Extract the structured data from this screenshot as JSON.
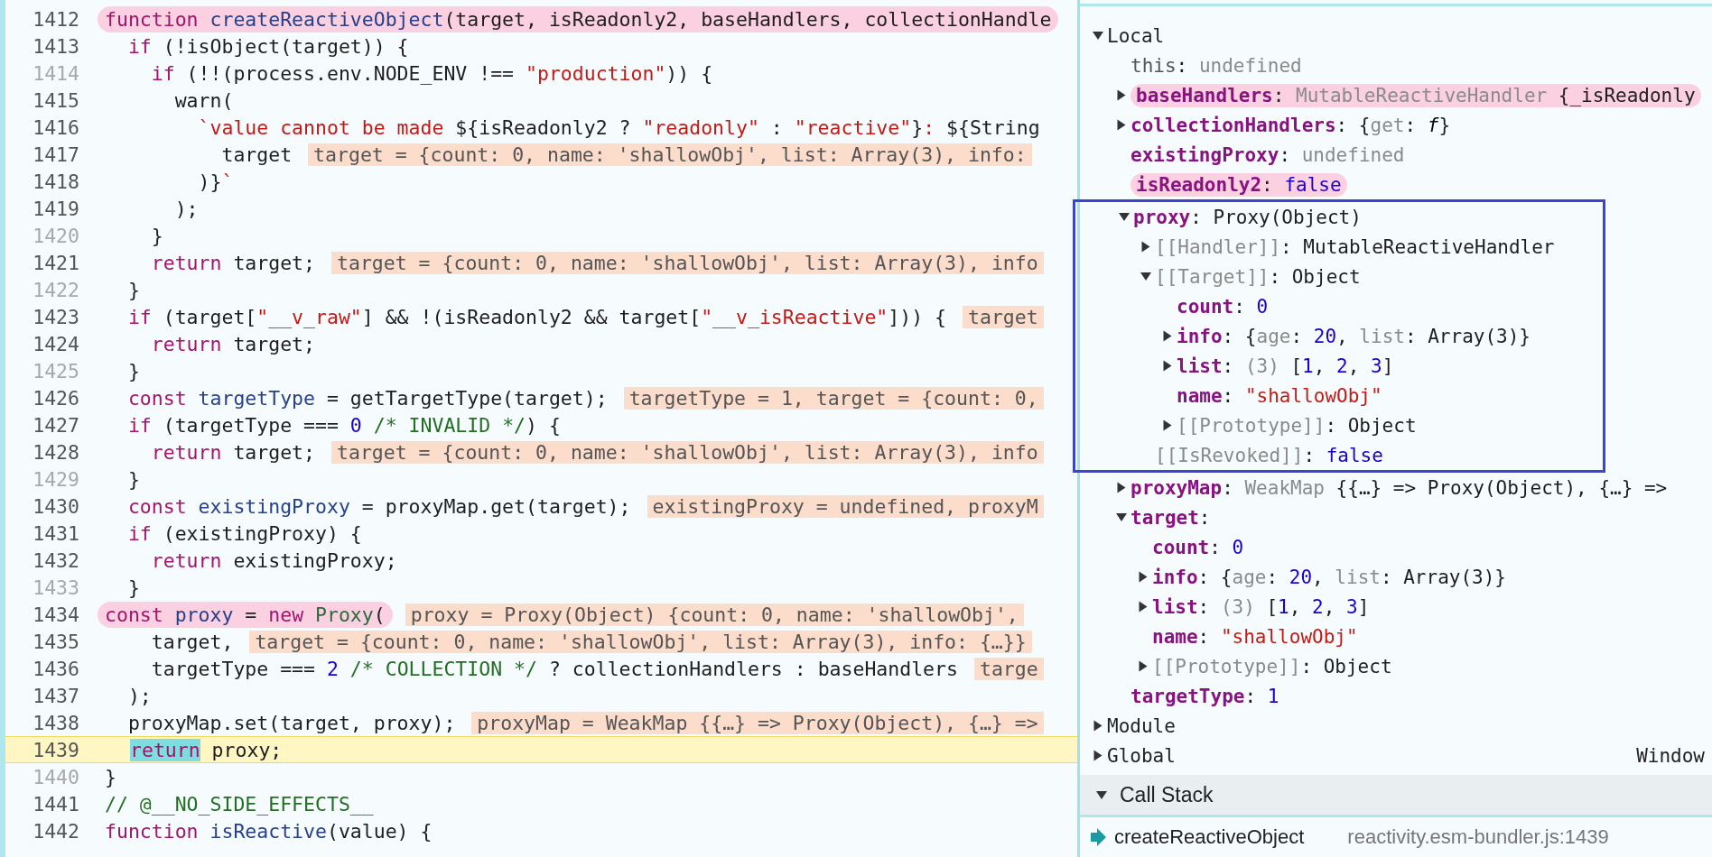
{
  "editor": {
    "lines": [
      {
        "number": "1412",
        "muted": false,
        "highlighted": true,
        "tokens": [
          {
            "kind": "keyword",
            "text": "function "
          },
          {
            "kind": "def",
            "text": "createReactiveObject"
          },
          {
            "kind": "plain",
            "text": "(target, isReadonly2, baseHandlers, collectionHandle"
          }
        ]
      },
      {
        "number": "1413",
        "muted": false,
        "tokens": [
          {
            "kind": "keyword",
            "text": "  if"
          },
          {
            "kind": "plain",
            "text": " (!isObject(target)) {"
          }
        ]
      },
      {
        "number": "1414",
        "muted": true,
        "tokens": [
          {
            "kind": "keyword",
            "text": "    if"
          },
          {
            "kind": "plain",
            "text": " (!!(process.env.NODE_ENV !== "
          },
          {
            "kind": "string",
            "text": "\"production\""
          },
          {
            "kind": "plain",
            "text": ")) {"
          }
        ]
      },
      {
        "number": "1415",
        "muted": false,
        "tokens": [
          {
            "kind": "plain",
            "text": "      warn("
          }
        ]
      },
      {
        "number": "1416",
        "muted": false,
        "tokens": [
          {
            "kind": "string",
            "text": "        `value cannot be made "
          },
          {
            "kind": "plain",
            "text": "${isReadonly2 ? "
          },
          {
            "kind": "string",
            "text": "\"readonly\""
          },
          {
            "kind": "plain",
            "text": " : "
          },
          {
            "kind": "string",
            "text": "\"reactive\""
          },
          {
            "kind": "plain",
            "text": "}"
          },
          {
            "kind": "string",
            "text": ": "
          },
          {
            "kind": "plain",
            "text": "${String"
          }
        ]
      },
      {
        "number": "1417",
        "muted": false,
        "tokens": [
          {
            "kind": "plain",
            "text": "          target"
          }
        ],
        "inline_value": "target = {count: 0, name: 'shallowObj', list: Array(3), info:"
      },
      {
        "number": "1418",
        "muted": false,
        "tokens": [
          {
            "kind": "plain",
            "text": "        )}"
          },
          {
            "kind": "string",
            "text": "`"
          }
        ]
      },
      {
        "number": "1419",
        "muted": false,
        "tokens": [
          {
            "kind": "plain",
            "text": "      );"
          }
        ]
      },
      {
        "number": "1420",
        "muted": true,
        "tokens": [
          {
            "kind": "plain",
            "text": "    }"
          }
        ]
      },
      {
        "number": "1421",
        "muted": false,
        "tokens": [
          {
            "kind": "keyword",
            "text": "    return"
          },
          {
            "kind": "plain",
            "text": " target;"
          }
        ],
        "inline_value": "target = {count: 0, name: 'shallowObj', list: Array(3), info"
      },
      {
        "number": "1422",
        "muted": true,
        "tokens": [
          {
            "kind": "plain",
            "text": "  }"
          }
        ]
      },
      {
        "number": "1423",
        "muted": false,
        "tokens": [
          {
            "kind": "keyword",
            "text": "  if"
          },
          {
            "kind": "plain",
            "text": " (target["
          },
          {
            "kind": "string",
            "text": "\"__v_raw\""
          },
          {
            "kind": "plain",
            "text": "] && !(isReadonly2 && target["
          },
          {
            "kind": "string",
            "text": "\"__v_isReactive\""
          },
          {
            "kind": "plain",
            "text": "])) {"
          }
        ],
        "inline_value": "target"
      },
      {
        "number": "1424",
        "muted": false,
        "tokens": [
          {
            "kind": "keyword",
            "text": "    return"
          },
          {
            "kind": "plain",
            "text": " target;"
          }
        ]
      },
      {
        "number": "1425",
        "muted": true,
        "tokens": [
          {
            "kind": "plain",
            "text": "  }"
          }
        ]
      },
      {
        "number": "1426",
        "muted": false,
        "tokens": [
          {
            "kind": "keyword",
            "text": "  const "
          },
          {
            "kind": "def",
            "text": "targetType"
          },
          {
            "kind": "plain",
            "text": " = getTargetType(target);"
          }
        ],
        "inline_value": "targetType = 1, target = {count: 0,"
      },
      {
        "number": "1427",
        "muted": false,
        "tokens": [
          {
            "kind": "keyword",
            "text": "  if"
          },
          {
            "kind": "plain",
            "text": " (targetType === "
          },
          {
            "kind": "number",
            "text": "0"
          },
          {
            "kind": "comment",
            "text": " /* INVALID */"
          },
          {
            "kind": "plain",
            "text": ") {"
          }
        ]
      },
      {
        "number": "1428",
        "muted": false,
        "tokens": [
          {
            "kind": "keyword",
            "text": "    return"
          },
          {
            "kind": "plain",
            "text": " target;"
          }
        ],
        "inline_value": "target = {count: 0, name: 'shallowObj', list: Array(3), info"
      },
      {
        "number": "1429",
        "muted": true,
        "tokens": [
          {
            "kind": "plain",
            "text": "  }"
          }
        ]
      },
      {
        "number": "1430",
        "muted": false,
        "tokens": [
          {
            "kind": "keyword",
            "text": "  const "
          },
          {
            "kind": "def",
            "text": "existingProxy"
          },
          {
            "kind": "plain",
            "text": " = proxyMap.get(target);"
          }
        ],
        "inline_value": "existingProxy = undefined, proxyM"
      },
      {
        "number": "1431",
        "muted": false,
        "tokens": [
          {
            "kind": "keyword",
            "text": "  if"
          },
          {
            "kind": "plain",
            "text": " (existingProxy) {"
          }
        ]
      },
      {
        "number": "1432",
        "muted": false,
        "tokens": [
          {
            "kind": "keyword",
            "text": "    return"
          },
          {
            "kind": "plain",
            "text": " existingProxy;"
          }
        ]
      },
      {
        "number": "1433",
        "muted": true,
        "tokens": [
          {
            "kind": "plain",
            "text": "  }"
          }
        ]
      },
      {
        "number": "1434",
        "muted": false,
        "highlighted": true,
        "tokens": [
          {
            "kind": "keyword",
            "text": "const "
          },
          {
            "kind": "def",
            "text": "proxy"
          },
          {
            "kind": "plain",
            "text": " = "
          },
          {
            "kind": "keyword",
            "text": "new "
          },
          {
            "kind": "class",
            "text": "Proxy"
          },
          {
            "kind": "plain",
            "text": "("
          }
        ],
        "inline_value": "proxy = Proxy(Object) {count: 0, name: 'shallowObj',"
      },
      {
        "number": "1435",
        "muted": false,
        "tokens": [
          {
            "kind": "plain",
            "text": "    target,"
          }
        ],
        "inline_value": "target = {count: 0, name: 'shallowObj', list: Array(3), info: {…}}"
      },
      {
        "number": "1436",
        "muted": false,
        "tokens": [
          {
            "kind": "plain",
            "text": "    targetType === "
          },
          {
            "kind": "number",
            "text": "2"
          },
          {
            "kind": "comment",
            "text": " /* COLLECTION */"
          },
          {
            "kind": "plain",
            "text": " ? collectionHandlers : baseHandlers"
          }
        ],
        "inline_value": "targe"
      },
      {
        "number": "1437",
        "muted": false,
        "tokens": [
          {
            "kind": "plain",
            "text": "  );"
          }
        ]
      },
      {
        "number": "1438",
        "muted": false,
        "tokens": [
          {
            "kind": "plain",
            "text": "  proxyMap.set(target, proxy);"
          }
        ],
        "inline_value": "proxyMap = WeakMap {{…} => Proxy(Object), {…} =>"
      },
      {
        "number": "1439",
        "muted": false,
        "current": true,
        "tokens": [
          {
            "kind": "keyword",
            "text": "return",
            "paused": true
          },
          {
            "kind": "plain",
            "text": " proxy;"
          }
        ]
      },
      {
        "number": "1440",
        "muted": true,
        "tokens": [
          {
            "kind": "plain",
            "text": "}"
          }
        ]
      },
      {
        "number": "1441",
        "muted": false,
        "tokens": [
          {
            "kind": "comment",
            "text": "// @__NO_SIDE_EFFECTS__"
          }
        ]
      },
      {
        "number": "1442",
        "muted": false,
        "tokens": [
          {
            "kind": "keyword",
            "text": "function "
          },
          {
            "kind": "def",
            "text": "isReactive"
          },
          {
            "kind": "plain",
            "text": "(value) {"
          }
        ]
      }
    ]
  },
  "scope": {
    "sections": [
      {
        "name": "Local",
        "expanded": true,
        "variables": [
          {
            "name": "this",
            "kind": "plain",
            "value": [
              {
                "kind": "plain",
                "text": ": "
              },
              {
                "kind": "dim",
                "text": "undefined"
              }
            ]
          },
          {
            "name": "baseHandlers",
            "kind": "own",
            "expanded": false,
            "highlighted": true,
            "value": [
              {
                "kind": "plain",
                "text": ": "
              },
              {
                "kind": "dim",
                "text": "MutableReactiveHandler"
              },
              {
                "kind": "plain",
                "text": " {_isReadonly"
              }
            ]
          },
          {
            "name": "collectionHandlers",
            "kind": "own",
            "expanded": false,
            "value": [
              {
                "kind": "plain",
                "text": ": {"
              },
              {
                "kind": "dim",
                "text": "get"
              },
              {
                "kind": "plain",
                "text": ": "
              },
              {
                "kind": "func",
                "text": "f"
              },
              {
                "kind": "plain",
                "text": "}"
              }
            ]
          },
          {
            "name": "existingProxy",
            "kind": "own",
            "value": [
              {
                "kind": "plain",
                "text": ": "
              },
              {
                "kind": "dim",
                "text": "undefined"
              }
            ]
          },
          {
            "name": "isReadonly2",
            "kind": "own",
            "highlighted": true,
            "value": [
              {
                "kind": "plain",
                "text": ": "
              },
              {
                "kind": "number",
                "text": "false"
              }
            ]
          },
          {
            "name": "proxy",
            "kind": "own",
            "expanded": true,
            "boxed": true,
            "value": [
              {
                "kind": "plain",
                "text": ": Proxy(Object)"
              }
            ],
            "children": [
              {
                "name": "[[Handler]]",
                "kind": "internal",
                "expanded": false,
                "value": [
                  {
                    "kind": "plain",
                    "text": ": MutableReactiveHandler"
                  }
                ]
              },
              {
                "name": "[[Target]]",
                "kind": "internal",
                "expanded": true,
                "value": [
                  {
                    "kind": "plain",
                    "text": ": Object"
                  }
                ],
                "children": [
                  {
                    "name": "count",
                    "kind": "own",
                    "value": [
                      {
                        "kind": "plain",
                        "text": ": "
                      },
                      {
                        "kind": "number",
                        "text": "0"
                      }
                    ]
                  },
                  {
                    "name": "info",
                    "kind": "own",
                    "expanded": false,
                    "value": [
                      {
                        "kind": "plain",
                        "text": ": {"
                      },
                      {
                        "kind": "dim",
                        "text": "age"
                      },
                      {
                        "kind": "plain",
                        "text": ": "
                      },
                      {
                        "kind": "number",
                        "text": "20"
                      },
                      {
                        "kind": "plain",
                        "text": ", "
                      },
                      {
                        "kind": "dim",
                        "text": "list"
                      },
                      {
                        "kind": "plain",
                        "text": ": Array(3)}"
                      }
                    ]
                  },
                  {
                    "name": "list",
                    "kind": "own",
                    "expanded": false,
                    "value": [
                      {
                        "kind": "plain",
                        "text": ": "
                      },
                      {
                        "kind": "dim",
                        "text": "(3)"
                      },
                      {
                        "kind": "plain",
                        "text": " ["
                      },
                      {
                        "kind": "number",
                        "text": "1"
                      },
                      {
                        "kind": "plain",
                        "text": ", "
                      },
                      {
                        "kind": "number",
                        "text": "2"
                      },
                      {
                        "kind": "plain",
                        "text": ", "
                      },
                      {
                        "kind": "number",
                        "text": "3"
                      },
                      {
                        "kind": "plain",
                        "text": "]"
                      }
                    ]
                  },
                  {
                    "name": "name",
                    "kind": "own",
                    "value": [
                      {
                        "kind": "plain",
                        "text": ": "
                      },
                      {
                        "kind": "string",
                        "text": "\"shallowObj\""
                      }
                    ]
                  },
                  {
                    "name": "[[Prototype]]",
                    "kind": "internal",
                    "expanded": false,
                    "value": [
                      {
                        "kind": "plain",
                        "text": ": Object"
                      }
                    ]
                  }
                ]
              },
              {
                "name": "[[IsRevoked]]",
                "kind": "internal",
                "value": [
                  {
                    "kind": "plain",
                    "text": ": "
                  },
                  {
                    "kind": "number",
                    "text": "false"
                  }
                ]
              }
            ]
          },
          {
            "name": "proxyMap",
            "kind": "own",
            "expanded": false,
            "value": [
              {
                "kind": "plain",
                "text": ": "
              },
              {
                "kind": "dim",
                "text": "WeakMap"
              },
              {
                "kind": "plain",
                "text": " {{…} => Proxy(Object), {…} =>"
              }
            ]
          },
          {
            "name": "target",
            "kind": "own",
            "expanded": true,
            "value": [
              {
                "kind": "plain",
                "text": ":"
              }
            ],
            "children": [
              {
                "name": "count",
                "kind": "own",
                "value": [
                  {
                    "kind": "plain",
                    "text": ": "
                  },
                  {
                    "kind": "number",
                    "text": "0"
                  }
                ]
              },
              {
                "name": "info",
                "kind": "own",
                "expanded": false,
                "value": [
                  {
                    "kind": "plain",
                    "text": ": {"
                  },
                  {
                    "kind": "dim",
                    "text": "age"
                  },
                  {
                    "kind": "plain",
                    "text": ": "
                  },
                  {
                    "kind": "number",
                    "text": "20"
                  },
                  {
                    "kind": "plain",
                    "text": ", "
                  },
                  {
                    "kind": "dim",
                    "text": "list"
                  },
                  {
                    "kind": "plain",
                    "text": ": Array(3)}"
                  }
                ]
              },
              {
                "name": "list",
                "kind": "own",
                "expanded": false,
                "value": [
                  {
                    "kind": "plain",
                    "text": ": "
                  },
                  {
                    "kind": "dim",
                    "text": "(3)"
                  },
                  {
                    "kind": "plain",
                    "text": " ["
                  },
                  {
                    "kind": "number",
                    "text": "1"
                  },
                  {
                    "kind": "plain",
                    "text": ", "
                  },
                  {
                    "kind": "number",
                    "text": "2"
                  },
                  {
                    "kind": "plain",
                    "text": ", "
                  },
                  {
                    "kind": "number",
                    "text": "3"
                  },
                  {
                    "kind": "plain",
                    "text": "]"
                  }
                ]
              },
              {
                "name": "name",
                "kind": "own",
                "value": [
                  {
                    "kind": "plain",
                    "text": ": "
                  },
                  {
                    "kind": "string",
                    "text": "\"shallowObj\""
                  }
                ]
              },
              {
                "name": "[[Prototype]]",
                "kind": "internal",
                "expanded": false,
                "value": [
                  {
                    "kind": "plain",
                    "text": ": Object"
                  }
                ]
              }
            ]
          },
          {
            "name": "targetType",
            "kind": "own",
            "value": [
              {
                "kind": "plain",
                "text": ": "
              },
              {
                "kind": "number",
                "text": "1"
              }
            ]
          }
        ]
      },
      {
        "name": "Module",
        "expanded": false
      },
      {
        "name": "Global",
        "expanded": false,
        "value": "Window"
      }
    ]
  },
  "call_stack": {
    "title": "Call Stack",
    "expanded": true,
    "frames": [
      {
        "function": "createReactiveObject",
        "location": "reactivity.esm-bundler.js:1439",
        "current": true
      }
    ]
  }
}
